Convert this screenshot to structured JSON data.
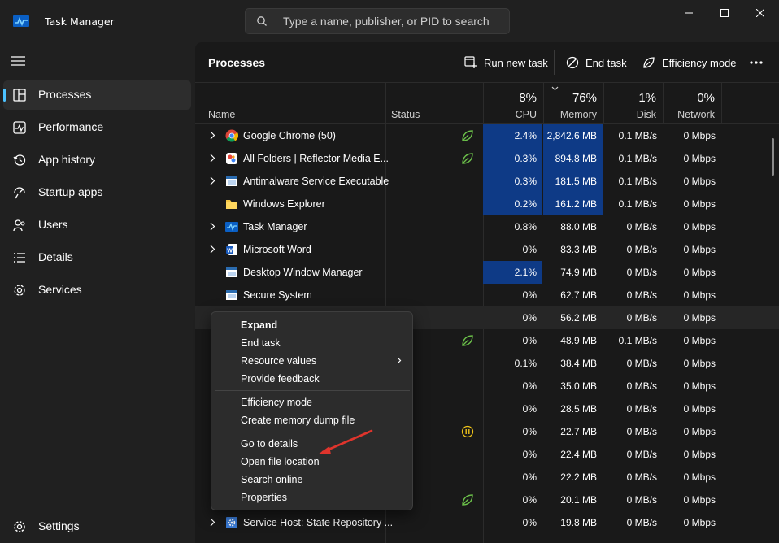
{
  "window": {
    "title": "Task Manager",
    "search_placeholder": "Type a name, publisher, or PID to search"
  },
  "sidebar": {
    "items": [
      {
        "label": "Processes",
        "icon": "processes-icon",
        "active": true
      },
      {
        "label": "Performance",
        "icon": "performance-icon"
      },
      {
        "label": "App history",
        "icon": "history-icon"
      },
      {
        "label": "Startup apps",
        "icon": "startup-icon"
      },
      {
        "label": "Users",
        "icon": "users-icon"
      },
      {
        "label": "Details",
        "icon": "details-icon"
      },
      {
        "label": "Services",
        "icon": "services-icon"
      }
    ],
    "settings_label": "Settings"
  },
  "toolbar": {
    "title": "Processes",
    "run_new_task": "Run new task",
    "end_task": "End task",
    "efficiency_mode": "Efficiency mode"
  },
  "columns": {
    "name": "Name",
    "status": "Status",
    "cpu_pct": "8%",
    "cpu": "CPU",
    "memory_pct": "76%",
    "memory": "Memory",
    "disk_pct": "1%",
    "disk": "Disk",
    "network_pct": "0%",
    "network": "Network"
  },
  "rows": [
    {
      "name": "Google Chrome (50)",
      "cpu": "2.4%",
      "memory": "2,842.6 MB",
      "disk": "0.1 MB/s",
      "network": "0 Mbps"
    },
    {
      "name": "All Folders | Reflector Media E...",
      "cpu": "0.3%",
      "memory": "894.8 MB",
      "disk": "0.1 MB/s",
      "network": "0 Mbps"
    },
    {
      "name": "Antimalware Service Executable",
      "cpu": "0.3%",
      "memory": "181.5 MB",
      "disk": "0.1 MB/s",
      "network": "0 Mbps"
    },
    {
      "name": "Windows Explorer",
      "cpu": "0.2%",
      "memory": "161.2 MB",
      "disk": "0.1 MB/s",
      "network": "0 Mbps"
    },
    {
      "name": "Task Manager",
      "cpu": "0.8%",
      "memory": "88.0 MB",
      "disk": "0 MB/s",
      "network": "0 Mbps"
    },
    {
      "name": "Microsoft Word",
      "cpu": "0%",
      "memory": "83.3 MB",
      "disk": "0 MB/s",
      "network": "0 Mbps"
    },
    {
      "name": "Desktop Window Manager",
      "cpu": "2.1%",
      "memory": "74.9 MB",
      "disk": "0 MB/s",
      "network": "0 Mbps"
    },
    {
      "name": "Secure System",
      "cpu": "0%",
      "memory": "62.7 MB",
      "disk": "0 MB/s",
      "network": "0 Mbps"
    },
    {
      "name": "",
      "cpu": "0%",
      "memory": "56.2 MB",
      "disk": "0 MB/s",
      "network": "0 Mbps"
    },
    {
      "name": "",
      "cpu": "0%",
      "memory": "48.9 MB",
      "disk": "0.1 MB/s",
      "network": "0 Mbps"
    },
    {
      "name": "",
      "cpu": "0.1%",
      "memory": "38.4 MB",
      "disk": "0 MB/s",
      "network": "0 Mbps"
    },
    {
      "name": "",
      "cpu": "0%",
      "memory": "35.0 MB",
      "disk": "0 MB/s",
      "network": "0 Mbps"
    },
    {
      "name": "",
      "cpu": "0%",
      "memory": "28.5 MB",
      "disk": "0 MB/s",
      "network": "0 Mbps"
    },
    {
      "name": "",
      "cpu": "0%",
      "memory": "22.7 MB",
      "disk": "0 MB/s",
      "network": "0 Mbps"
    },
    {
      "name": "",
      "cpu": "0%",
      "memory": "22.4 MB",
      "disk": "0 MB/s",
      "network": "0 Mbps"
    },
    {
      "name": "",
      "cpu": "0%",
      "memory": "22.2 MB",
      "disk": "0 MB/s",
      "network": "0 Mbps"
    },
    {
      "name": "",
      "cpu": "0%",
      "memory": "20.1 MB",
      "disk": "0 MB/s",
      "network": "0 Mbps"
    },
    {
      "name": "Service Host: State Repository ...",
      "cpu": "0%",
      "memory": "19.8 MB",
      "disk": "0 MB/s",
      "network": "0 Mbps"
    }
  ],
  "context_menu": {
    "expand": "Expand",
    "end_task": "End task",
    "resource_values": "Resource values",
    "provide_feedback": "Provide feedback",
    "efficiency_mode": "Efficiency mode",
    "create_dump": "Create memory dump file",
    "go_to_details": "Go to details",
    "open_file_location": "Open file location",
    "search_online": "Search online",
    "properties": "Properties"
  },
  "colors": {
    "accent": "#4cc2ff",
    "highlight": "#0e3a86",
    "efficiency_leaf": "#6cc24a",
    "paused": "#f0c419",
    "annotation_arrow": "#e0342c"
  }
}
